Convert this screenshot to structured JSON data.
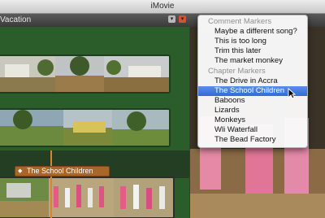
{
  "window": {
    "title": "iMovie"
  },
  "project": {
    "name": "Vacation"
  },
  "header_buttons": [
    {
      "icon": "view-options-icon",
      "glyph": "▾"
    },
    {
      "icon": "markers-menu-icon",
      "glyph": "▾"
    }
  ],
  "browser": {
    "chapter_flag": {
      "label": "The School Children",
      "icon": "chapter-marker-icon"
    }
  },
  "menu": {
    "comment_header": "Comment Markers",
    "comment_items": [
      "Maybe a different song?",
      "This is too long",
      "Trim this later",
      "The market monkey"
    ],
    "chapter_header": "Chapter Markers",
    "chapter_items": [
      "The Drive in Accra",
      "The School Children",
      "Baboons",
      "Lizards",
      "Monkeys",
      "Wli Waterfall",
      "The Bead Factory"
    ],
    "selected": "The School Children"
  },
  "colors": {
    "browser_bg": "#2b5d2b",
    "selection": "#2f6ad8",
    "chapter_flag": "#a8662b",
    "playhead": "#d6843a"
  }
}
